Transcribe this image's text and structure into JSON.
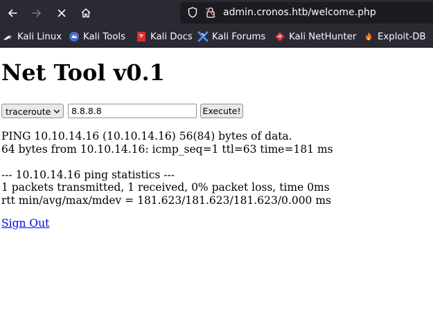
{
  "browser": {
    "url": "admin.cronos.htb/welcome.php",
    "bookmarks": [
      {
        "label": "Kali Linux",
        "icon": "kali-dragon-icon"
      },
      {
        "label": "Kali Tools",
        "icon": "kali-tools-icon"
      },
      {
        "label": "Kali Docs",
        "icon": "kali-docs-icon"
      },
      {
        "label": "Kali Forums",
        "icon": "kali-forums-icon"
      },
      {
        "label": "Kali NetHunter",
        "icon": "kali-nethunter-icon"
      },
      {
        "label": "Exploit-DB",
        "icon": "exploit-db-icon"
      }
    ]
  },
  "page": {
    "title": "Net Tool v0.1",
    "command_select": {
      "selected": "traceroute",
      "options": [
        "traceroute"
      ]
    },
    "host_input": {
      "value": "8.8.8.8"
    },
    "execute_label": "Execute!",
    "output_lines": [
      "PING 10.10.14.16 (10.10.14.16) 56(84) bytes of data.",
      "64 bytes from 10.10.14.16: icmp_seq=1 ttl=63 time=181 ms",
      "",
      "--- 10.10.14.16 ping statistics ---",
      "1 packets transmitted, 1 received, 0% packet loss, time 0ms",
      "rtt min/avg/max/mdev = 181.623/181.623/181.623/0.000 ms"
    ],
    "signout_label": "Sign Out"
  },
  "colors": {
    "chrome_bg": "#2b2a33",
    "urlbar_bg": "#1c1b22",
    "link": "#0000ee",
    "page_bg": "#ffffff"
  }
}
